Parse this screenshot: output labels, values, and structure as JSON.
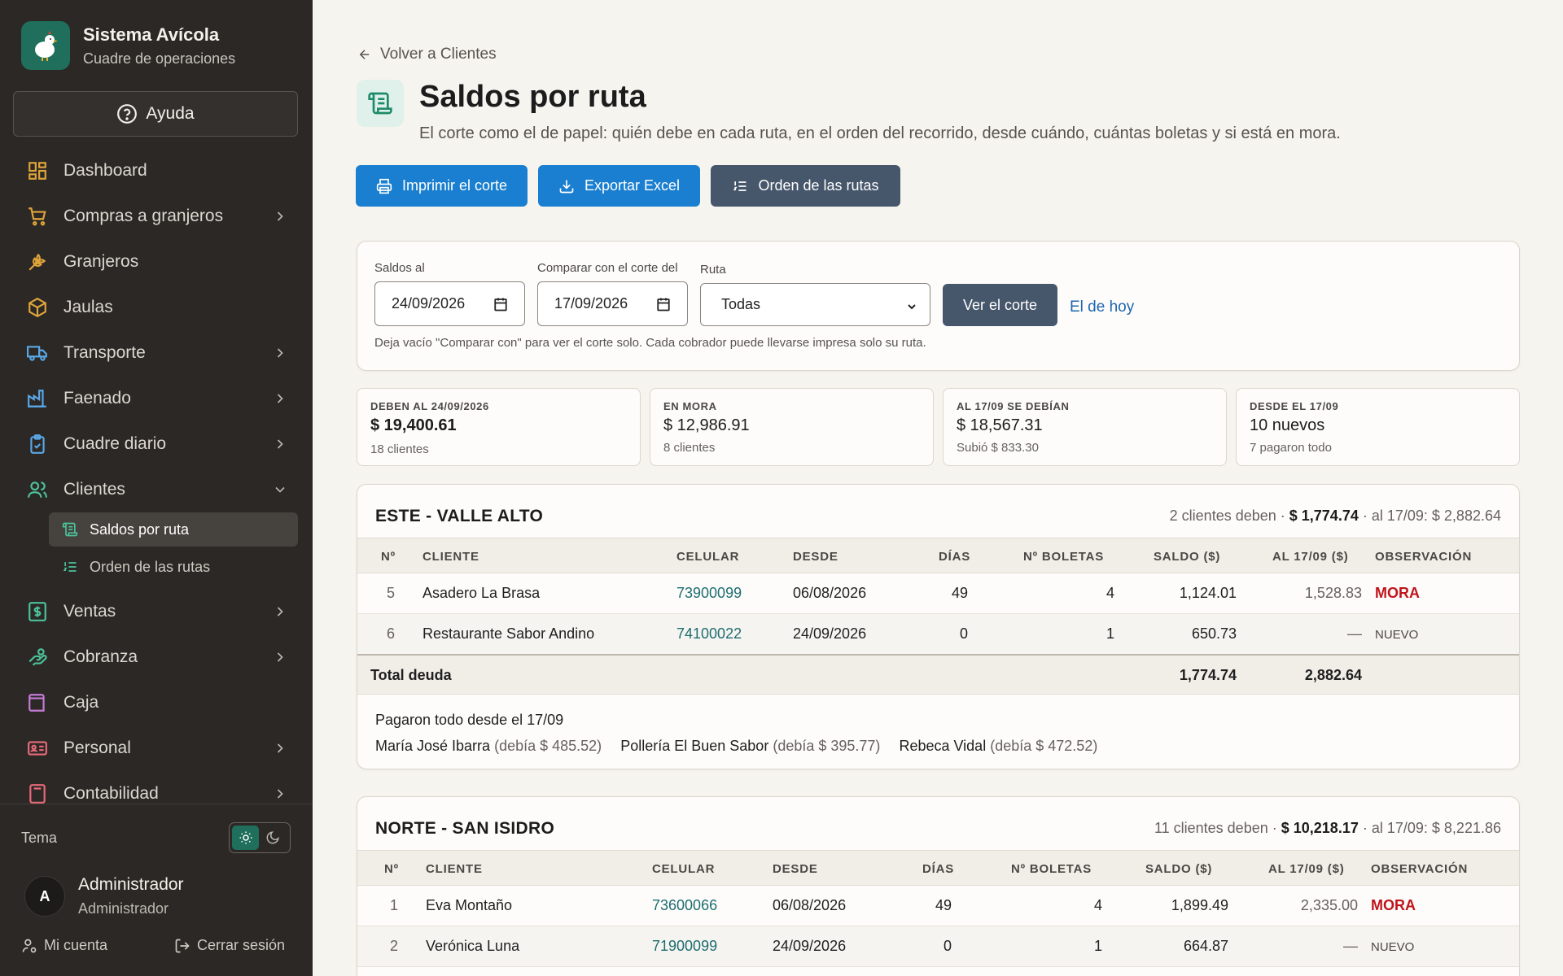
{
  "brand": {
    "title": "Sistema Avícola",
    "subtitle": "Cuadre de operaciones"
  },
  "help_label": "Ayuda",
  "nav": [
    {
      "label": "Dashboard",
      "icon": "dashboard-icon"
    },
    {
      "label": "Compras a granjeros",
      "icon": "cart-icon"
    },
    {
      "label": "Granjeros",
      "icon": "wheat-icon"
    },
    {
      "label": "Jaulas",
      "icon": "box-icon"
    },
    {
      "label": "Transporte",
      "icon": "truck-icon"
    },
    {
      "label": "Faenado",
      "icon": "factory-icon"
    },
    {
      "label": "Cuadre diario",
      "icon": "clipboard-icon"
    },
    {
      "label": "Clientes",
      "icon": "users-icon"
    },
    {
      "label": "Ventas",
      "icon": "dollar-icon"
    },
    {
      "label": "Cobranza",
      "icon": "hand-coins-icon"
    },
    {
      "label": "Caja",
      "icon": "wallet-icon"
    },
    {
      "label": "Personal",
      "icon": "id-card-icon"
    },
    {
      "label": "Contabilidad",
      "icon": "calculator-icon"
    }
  ],
  "subnav": [
    {
      "label": "Saldos por ruta",
      "icon": "scroll-icon"
    },
    {
      "label": "Orden de las rutas",
      "icon": "list-ordered-icon"
    }
  ],
  "theme_label": "Tema",
  "user": {
    "initial": "A",
    "name": "Administrador",
    "role": "Administrador"
  },
  "footer": {
    "account": "Mi cuenta",
    "logout": "Cerrar sesión"
  },
  "back_label": "Volver a Clientes",
  "page": {
    "title": "Saldos por ruta",
    "description": "El corte como el de papel: quién debe en cada ruta, en el orden del recorrido, desde cuándo, cuántas boletas y si está en mora."
  },
  "actions": {
    "print": "Imprimir el corte",
    "export": "Exportar Excel",
    "order": "Orden de las rutas"
  },
  "filters": {
    "saldos_label": "Saldos al",
    "saldos_value": "24/09/2026",
    "comparar_label": "Comparar con el corte del",
    "comparar_value": "17/09/2026",
    "ruta_label": "Ruta",
    "ruta_value": "Todas",
    "submit": "Ver el corte",
    "today": "El de hoy",
    "hint": "Deja vacío \"Comparar con\" para ver el corte solo. Cada cobrador puede llevarse impresa solo su ruta."
  },
  "stats": [
    {
      "label": "DEBEN AL 24/09/2026",
      "value": "$ 19,400.61",
      "sub": "18 clientes"
    },
    {
      "label": "EN MORA",
      "value": "$ 12,986.91",
      "sub": "8 clientes"
    },
    {
      "label": "AL 17/09 SE DEBÍAN",
      "value": "$ 18,567.31",
      "sub": "Subió $ 833.30"
    },
    {
      "label": "DESDE EL 17/09",
      "value": "10 nuevos",
      "sub": "7 pagaron todo"
    }
  ],
  "columns": [
    "Nº",
    "CLIENTE",
    "CELULAR",
    "DESDE",
    "DÍAS",
    "Nº BOLETAS",
    "SALDO ($)",
    "AL 17/09 ($)",
    "OBSERVACIÓN"
  ],
  "routes": [
    {
      "name": "ESTE - VALLE ALTO",
      "summary_prefix": "2 clientes deben ·",
      "summary_amount": "$ 1,774.74",
      "summary_suffix": "· al 17/09: $ 2,882.64",
      "rows": [
        {
          "n": "5",
          "cliente": "Asadero La Brasa",
          "celular": "73900099",
          "desde": "06/08/2026",
          "dias": "49",
          "boletas": "4",
          "saldo": "1,124.01",
          "prev": "1,528.83",
          "obs": "MORA"
        },
        {
          "n": "6",
          "cliente": "Restaurante Sabor Andino",
          "celular": "74100022",
          "desde": "24/09/2026",
          "dias": "0",
          "boletas": "1",
          "saldo": "650.73",
          "prev": "—",
          "obs": "NUEVO"
        }
      ],
      "total_label": "Total deuda",
      "total_saldo": "1,774.74",
      "total_prev": "2,882.64",
      "paid_title": "Pagaron todo desde el 17/09",
      "paid": [
        {
          "name": "María José Ibarra",
          "owed": "(debía $ 485.52)"
        },
        {
          "name": "Pollería El Buen Sabor",
          "owed": "(debía $ 395.77)"
        },
        {
          "name": "Rebeca Vidal",
          "owed": "(debía $ 472.52)"
        }
      ]
    },
    {
      "name": "NORTE - SAN ISIDRO",
      "summary_prefix": "11 clientes deben ·",
      "summary_amount": "$ 10,218.17",
      "summary_suffix": "· al 17/09: $ 8,221.86",
      "rows": [
        {
          "n": "1",
          "cliente": "Eva Montaño",
          "celular": "73600066",
          "desde": "06/08/2026",
          "dias": "49",
          "boletas": "4",
          "saldo": "1,899.49",
          "prev": "2,335.00",
          "obs": "MORA"
        },
        {
          "n": "2",
          "cliente": "Verónica Luna",
          "celular": "71900099",
          "desde": "24/09/2026",
          "dias": "0",
          "boletas": "1",
          "saldo": "664.87",
          "prev": "—",
          "obs": "NUEVO"
        }
      ]
    }
  ],
  "colors": {
    "sidebar": "#2b2826",
    "accent_green": "#1f6f5c",
    "primary_blue": "#1a7fd0",
    "slate": "#46566b",
    "mora_red": "#c0141c"
  }
}
